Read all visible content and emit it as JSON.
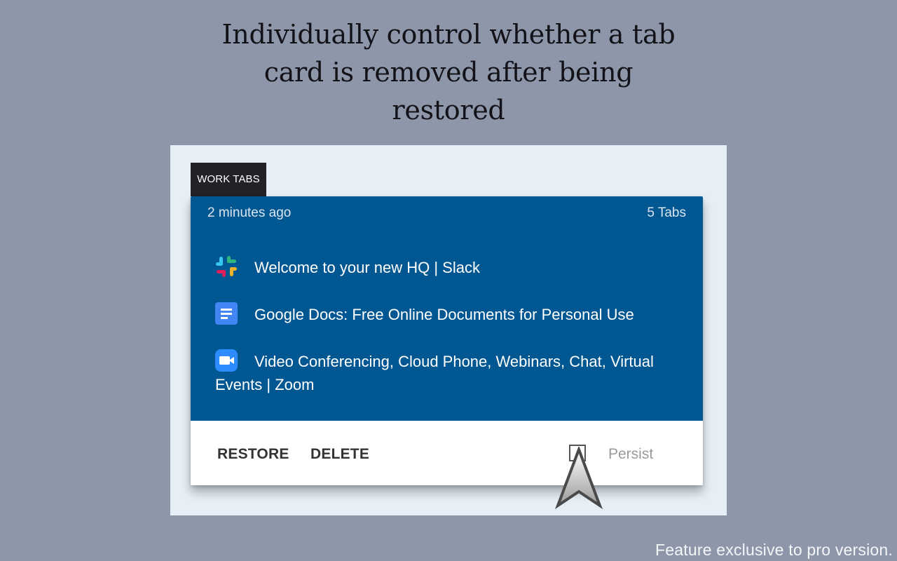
{
  "headline": {
    "line1": "Individually control whether a tab",
    "line2": "card is removed after being",
    "line3": "restored"
  },
  "group": {
    "name": "WORK TABS"
  },
  "card": {
    "time": "2 minutes ago",
    "count": "5 Tabs",
    "tabs": [
      {
        "title": "Welcome to your new HQ | Slack",
        "icon": "slack-icon"
      },
      {
        "title": "Google Docs: Free Online Documents for Personal Use",
        "icon": "google-docs-icon"
      },
      {
        "title": "Video Conferencing, Cloud Phone, Webinars, Chat, Virtual Events | Zoom",
        "icon": "zoom-icon"
      }
    ],
    "actions": {
      "restore": "RESTORE",
      "delete": "DELETE",
      "persist": "Persist"
    },
    "persist_checked": false
  },
  "footnote": "Feature exclusive to pro version.",
  "colors": {
    "background": "#8e97aa",
    "card_header": "#005791",
    "group_tag": "#202226",
    "panel": "#e6eef6"
  }
}
